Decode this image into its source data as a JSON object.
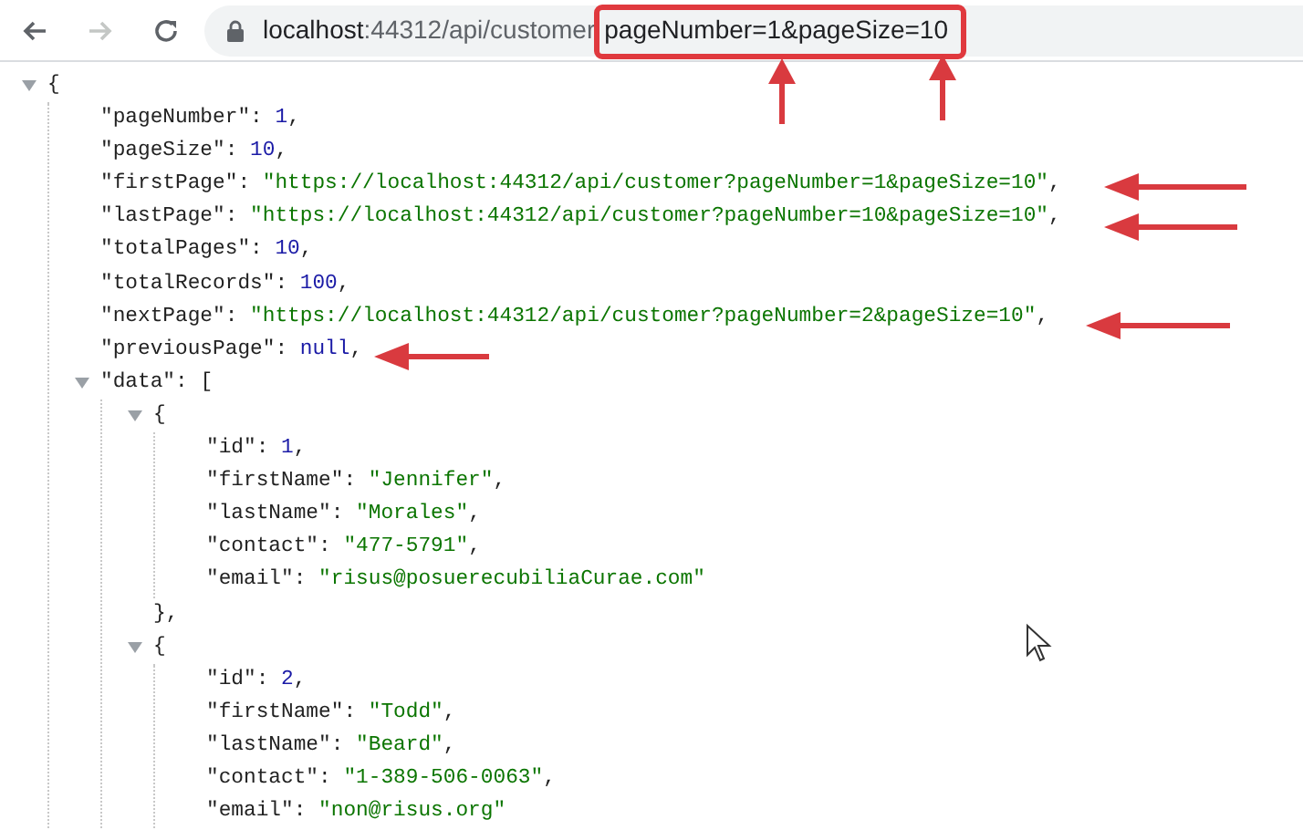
{
  "toolbar": {
    "back": {
      "disabled": false
    },
    "forward": {
      "disabled": true
    },
    "url_host": "localhost",
    "url_path": ":44312/api/customer",
    "url_query": "pageNumber=1&pageSize=10"
  },
  "json_viewer": {
    "open": "{",
    "expanded": true,
    "children": [
      {
        "key": "\"pageNumber\":",
        "value": "1",
        "kind": "number",
        "end": ","
      },
      {
        "key": "\"pageSize\":",
        "value": "10",
        "kind": "number",
        "end": ","
      },
      {
        "key": "\"firstPage\":",
        "value": "\"https://localhost:44312/api/customer?pageNumber=1&pageSize=10\"",
        "kind": "string",
        "end": ","
      },
      {
        "key": "\"lastPage\":",
        "value": "\"https://localhost:44312/api/customer?pageNumber=10&pageSize=10\"",
        "kind": "string",
        "end": ","
      },
      {
        "key": "\"totalPages\":",
        "value": "10",
        "kind": "number",
        "end": ","
      },
      {
        "key": "\"totalRecords\":",
        "value": "100",
        "kind": "number",
        "end": ","
      },
      {
        "key": "\"nextPage\":",
        "value": "\"https://localhost:44312/api/customer?pageNumber=2&pageSize=10\"",
        "kind": "string",
        "end": ","
      },
      {
        "key": "\"previousPage\":",
        "value": "null",
        "kind": "null",
        "end": ","
      },
      {
        "key": "\"data\":",
        "open": "[",
        "expanded": true,
        "children": [
          {
            "open": "{",
            "expanded": true,
            "close": "},",
            "children": [
              {
                "key": "\"id\":",
                "value": "1",
                "kind": "number",
                "end": ","
              },
              {
                "key": "\"firstName\":",
                "value": "\"Jennifer\"",
                "kind": "string",
                "end": ","
              },
              {
                "key": "\"lastName\":",
                "value": "\"Morales\"",
                "kind": "string",
                "end": ","
              },
              {
                "key": "\"contact\":",
                "value": "\"477-5791\"",
                "kind": "string",
                "end": ","
              },
              {
                "key": "\"email\":",
                "value": "\"risus@posuerecubiliaCurae.com\"",
                "kind": "string"
              }
            ]
          },
          {
            "open": "{",
            "expanded": true,
            "children": [
              {
                "key": "\"id\":",
                "value": "2",
                "kind": "number",
                "end": ","
              },
              {
                "key": "\"firstName\":",
                "value": "\"Todd\"",
                "kind": "string",
                "end": ","
              },
              {
                "key": "\"lastName\":",
                "value": "\"Beard\"",
                "kind": "string",
                "end": ","
              },
              {
                "key": "\"contact\":",
                "value": "\"1-389-506-0063\"",
                "kind": "string",
                "end": ","
              },
              {
                "key": "\"email\":",
                "value": "\"non@risus.org\"",
                "kind": "string"
              }
            ]
          }
        ]
      }
    ]
  }
}
